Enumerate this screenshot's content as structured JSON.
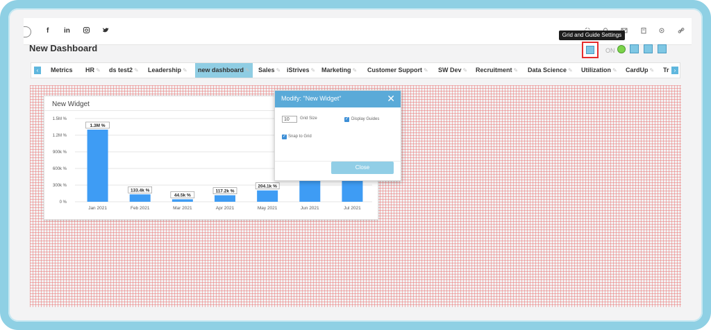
{
  "topbar": {
    "social": [
      "f",
      "in",
      "◘",
      "🐦"
    ],
    "icons": [
      "refresh-icon",
      "bell-icon",
      "mail-icon",
      "clipboard-icon",
      "settings-icon",
      "link-icon"
    ]
  },
  "tooltip": {
    "text": "Grid and Guide Settings"
  },
  "page": {
    "title": "New Dashboard"
  },
  "toolbar": {
    "on_label": "ON"
  },
  "tabs": [
    {
      "label": "Metrics",
      "editable": false
    },
    {
      "label": "HR",
      "editable": true
    },
    {
      "label": "ds test2",
      "editable": true
    },
    {
      "label": "Leadership",
      "editable": true
    },
    {
      "label": "new dashboard",
      "editable": true,
      "active": true
    },
    {
      "label": "Sales",
      "editable": true
    },
    {
      "label": "iStrives",
      "editable": true
    },
    {
      "label": "Marketing",
      "editable": true
    },
    {
      "label": "Customer Support",
      "editable": true
    },
    {
      "label": "SW Dev",
      "editable": true
    },
    {
      "label": "Recruitment",
      "editable": true
    },
    {
      "label": "Data Science",
      "editable": true
    },
    {
      "label": "Utilization",
      "editable": true
    },
    {
      "label": "CardUp",
      "editable": true
    },
    {
      "label": "Tr",
      "editable": false
    }
  ],
  "widget": {
    "title": "New Widget"
  },
  "chart_data": {
    "type": "bar",
    "categories": [
      "Jan 2021",
      "Feb 2021",
      "Mar 2021",
      "Apr 2021",
      "May 2021",
      "Jun 2021",
      "Jul 2021"
    ],
    "values": [
      1300000,
      133400,
      44500,
      117200,
      204100,
      450000,
      450000
    ],
    "data_labels": [
      "1.3M %",
      "133.4k %",
      "44.5k %",
      "117.2k %",
      "204.1k %",
      "",
      ""
    ],
    "y_ticks": [
      "0 %",
      "300k %",
      "600k %",
      "900k %",
      "1.2M %",
      "1.5M %"
    ],
    "y_tick_values": [
      0,
      300000,
      600000,
      900000,
      1200000,
      1500000
    ],
    "ylim": [
      0,
      1500000
    ],
    "bar_color": "#3e9cf4",
    "grid": true
  },
  "modal": {
    "title": "Modify: \"New Widget\"",
    "grid_size_value": "10",
    "grid_size_label": "Grid Size",
    "display_guides_label": "Display Guides",
    "snap_to_grid_label": "Snap to Grid",
    "close_label": "Close"
  },
  "colors": {
    "accent": "#5aaad8",
    "active_tab": "#8fcde3",
    "highlight_box": "#e52c2c",
    "frame": "#8fd0e4",
    "grid_lines": "#eb7878"
  }
}
